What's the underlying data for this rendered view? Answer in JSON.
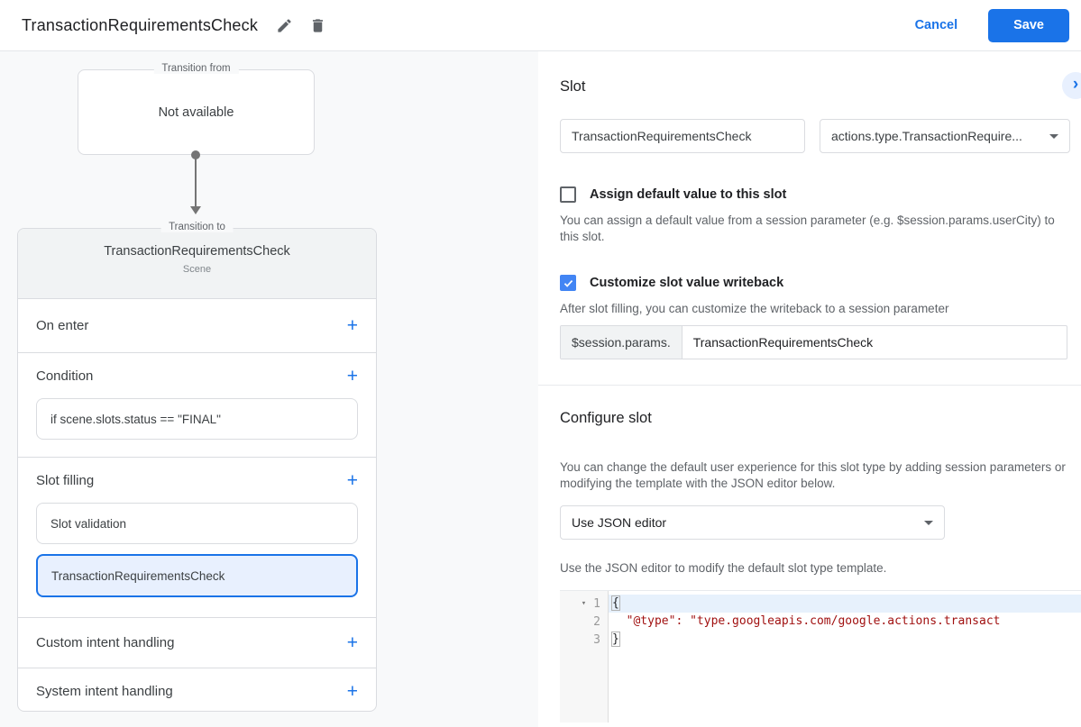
{
  "header": {
    "title": "TransactionRequirementsCheck",
    "cancel": "Cancel",
    "save": "Save"
  },
  "icons": {
    "add": "+",
    "chevron_right": "›",
    "fold_arrow": "▾"
  },
  "colors": {
    "accent": "#1a73e8",
    "checkbox_checked": "#4285f4",
    "selected_item_bg": "#e8f0fe",
    "code_string": "#a11111"
  },
  "diagram": {
    "from_legend": "Transition from",
    "from_content": "Not available",
    "to_legend": "Transition to",
    "scene_title": "TransactionRequirementsCheck",
    "scene_subtitle": "Scene",
    "on_enter_label": "On enter",
    "condition_label": "Condition",
    "condition_value": "if scene.slots.status == \"FINAL\"",
    "slot_filling_label": "Slot filling",
    "slot_items": [
      {
        "label": "Slot validation",
        "selected": false
      },
      {
        "label": "TransactionRequirementsCheck",
        "selected": true
      }
    ],
    "custom_intent_label": "Custom intent handling",
    "system_intent_label": "System intent handling"
  },
  "slot_panel": {
    "heading": "Slot",
    "name_value": "TransactionRequirementsCheck",
    "type_value": "actions.type.TransactionRequire...",
    "assign_default_label": "Assign default value to this slot",
    "assign_default_checked": false,
    "assign_default_desc": "You can assign a default value from a session parameter (e.g. $session.params.userCity) to this slot.",
    "writeback_label": "Customize slot value writeback",
    "writeback_checked": true,
    "writeback_desc": "After slot filling, you can customize the writeback to a session parameter",
    "writeback_prefix": "$session.params.",
    "writeback_value": "TransactionRequirementsCheck"
  },
  "configure_panel": {
    "heading": "Configure slot",
    "description": "You can change the default user experience for this slot type by adding session parameters or modifying the template with the JSON editor below.",
    "editor_select_value": "Use JSON editor",
    "editor_hint": "Use the JSON editor to modify the default slot type template.",
    "code_lines": [
      {
        "num": "1",
        "text": "{"
      },
      {
        "num": "2",
        "text": "  \"@type\": \"type.googleapis.com/google.actions.transact"
      },
      {
        "num": "3",
        "text": "}"
      }
    ]
  }
}
